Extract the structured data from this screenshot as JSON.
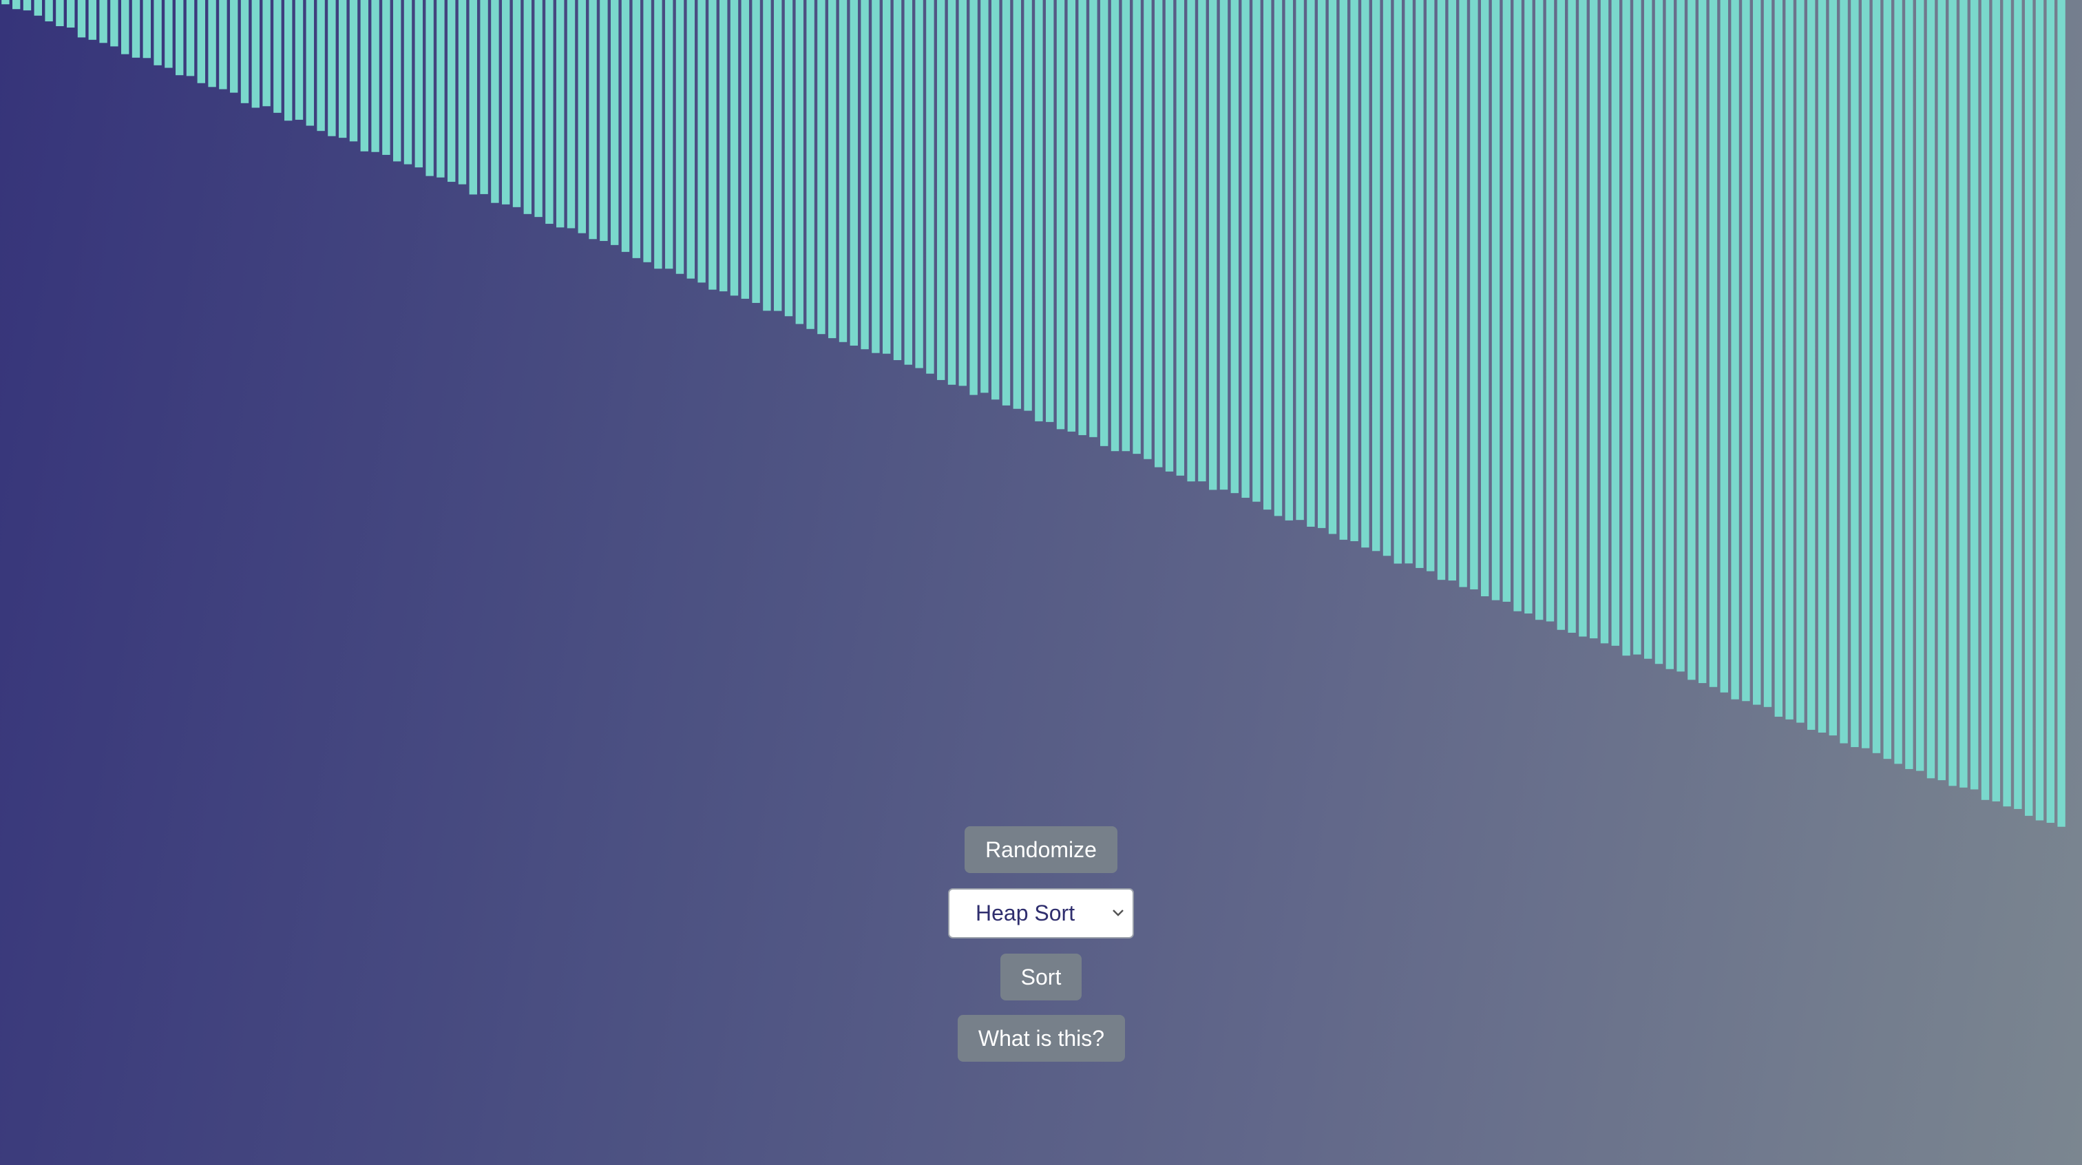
{
  "colors": {
    "bar": "#7ad8cc",
    "button_bg": "#77808a",
    "button_text": "#ffffff",
    "select_text": "#2f2e6e"
  },
  "visualization": {
    "bar_count": 190,
    "order": "ascending",
    "max_value_fraction": 0.71
  },
  "controls": {
    "randomize_label": "Randomize",
    "algorithm_select": {
      "selected": "Heap Sort"
    },
    "sort_label": "Sort",
    "about_label": "What is this?"
  },
  "icons": {
    "select_chevron": "chevron-down-icon"
  }
}
